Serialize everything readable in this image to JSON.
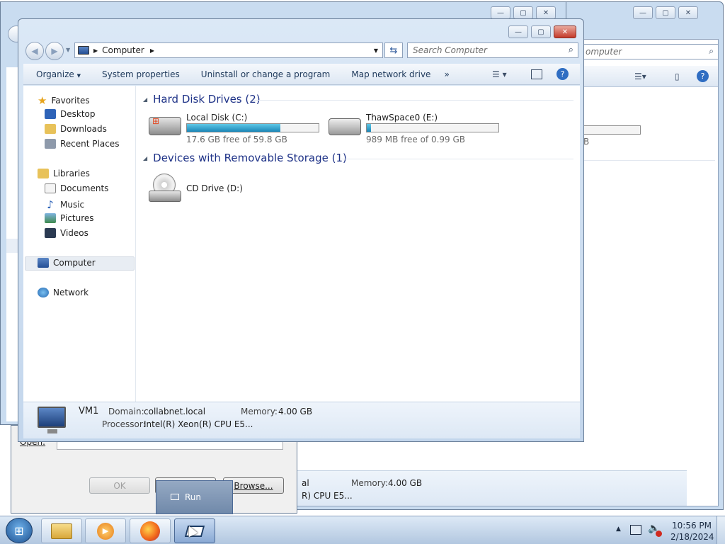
{
  "explorer": {
    "address": "Computer",
    "search_placeholder": "Search Computer",
    "commands": [
      "Organize",
      "System properties",
      "Uninstall or change a program",
      "Map network drive",
      "»"
    ],
    "nav": {
      "favorites": "Favorites",
      "desktop": "Desktop",
      "downloads": "Downloads",
      "recent": "Recent Places",
      "libraries": "Libraries",
      "documents": "Documents",
      "music": "Music",
      "pictures": "Pictures",
      "videos": "Videos",
      "computer": "Computer",
      "network": "Network"
    },
    "hdd_header": "Hard Disk Drives (2)",
    "removable_header": "Devices with Removable Storage (1)",
    "drives": [
      {
        "name": "Local Disk (C:)",
        "free": "17.6 GB free of 59.8 GB",
        "used_fraction": 0.71
      },
      {
        "name": "ThawSpace0 (E:)",
        "free": "989 MB free of 0.99 GB",
        "used_fraction": 0.03
      }
    ],
    "cd_drive": "CD Drive (D:)",
    "details": {
      "name": "VM1",
      "domain_label": "Domain:",
      "domain": "collabnet.local",
      "memory_label": "Memory:",
      "memory": "4.00 GB",
      "processor_label": "Processor:",
      "processor": "Intel(R) Xeon(R) CPU E5..."
    }
  },
  "background_window": {
    "search_placeholder": "omputer",
    "free_partial": "B",
    "memory_label": "Memory:",
    "memory": "4.00 GB",
    "domain_partial": "al",
    "processor_partial": "R) CPU E5..."
  },
  "run_dialog": {
    "open_label": "Open:",
    "ok": "OK",
    "browse": "Browse...",
    "popup": "Run"
  },
  "taskbar": {
    "time": "10:56 PM",
    "date": "2/18/2024"
  },
  "colors": {
    "accent": "#1e3287",
    "drive_fill": "#26a0da"
  }
}
